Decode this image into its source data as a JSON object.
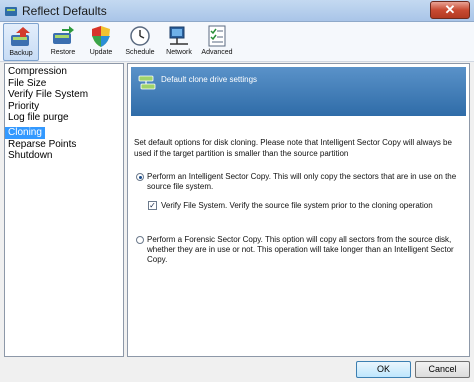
{
  "window": {
    "title": "Reflect Defaults",
    "close_label": "✕"
  },
  "toolbar": {
    "items": [
      {
        "label": "Backup",
        "icon": "backup-icon",
        "active": true
      },
      {
        "label": "Restore",
        "icon": "restore-icon"
      },
      {
        "label": "Update",
        "icon": "shield-icon"
      },
      {
        "label": "Schedule",
        "icon": "clock-icon"
      },
      {
        "label": "Network",
        "icon": "network-icon"
      },
      {
        "label": "Advanced",
        "icon": "checklist-icon"
      }
    ]
  },
  "sidebar": {
    "items": [
      {
        "label": "Compression"
      },
      {
        "label": "File Size"
      },
      {
        "label": "Verify File System"
      },
      {
        "label": "Priority"
      },
      {
        "label": "Log file purge"
      },
      {
        "label": "Cloning",
        "selected": true
      },
      {
        "label": "Reparse Points"
      },
      {
        "label": "Shutdown"
      }
    ]
  },
  "panel": {
    "banner_title": "Default clone drive settings",
    "description": "Set default options for disk cloning.  Please note that Intelligent Sector Copy will always be used if the target partition is smaller than the source partition",
    "option_intelligent": "Perform an Intelligent Sector Copy.  This will only copy the sectors that are in use on the source file system.",
    "option_verify": "Verify File System.  Verify the source file system prior to the cloning operation",
    "option_forensic": "Perform a Forensic Sector Copy.  This option will copy all sectors from the source disk, whether they are in use or not.  This operation will take longer than an Intelligent Sector Copy."
  },
  "buttons": {
    "ok": "OK",
    "cancel": "Cancel"
  },
  "colors": {
    "selection": "#3399ff",
    "banner": "#2f6ca8"
  }
}
